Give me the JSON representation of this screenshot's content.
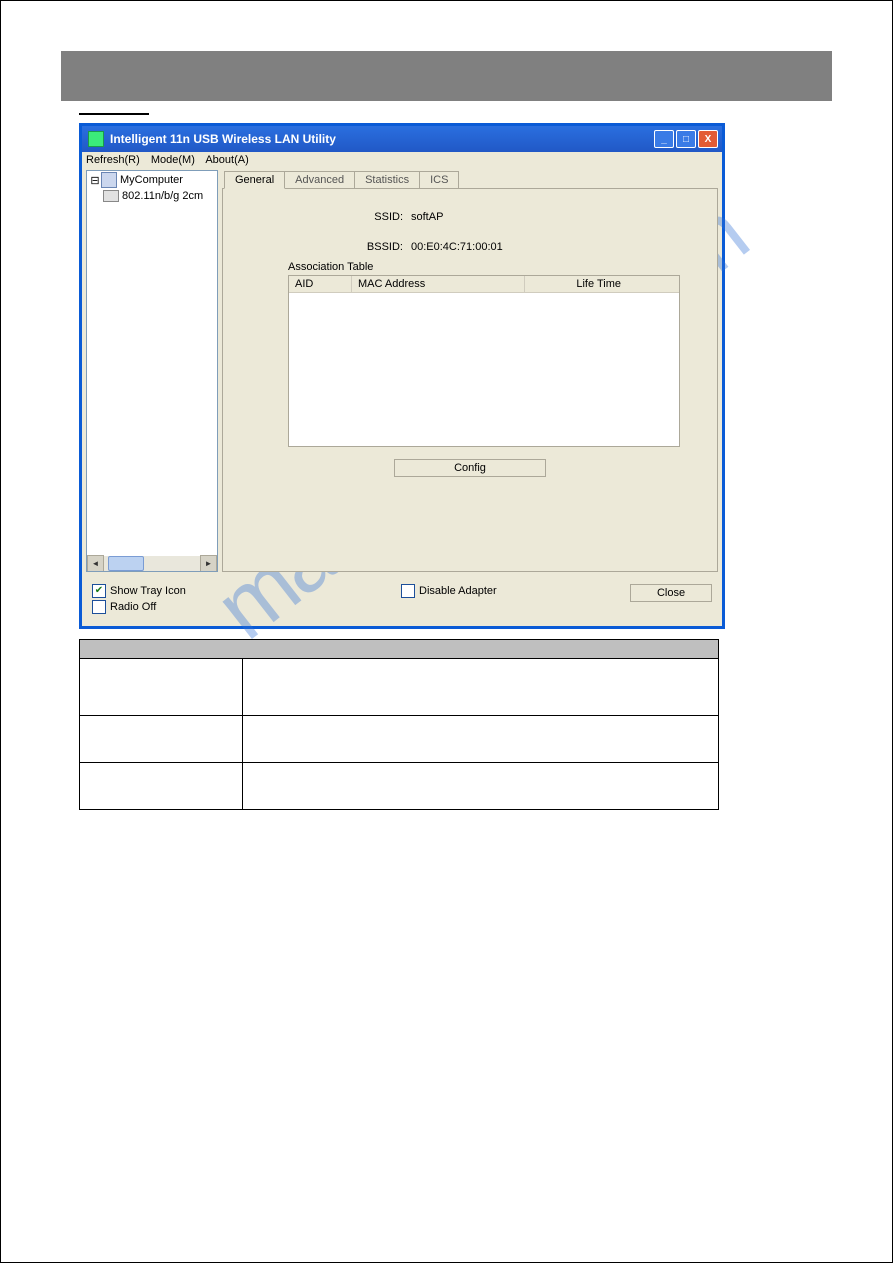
{
  "window": {
    "title": "Intelligent 11n USB Wireless LAN Utility",
    "menu": {
      "refresh": "Refresh(R)",
      "mode": "Mode(M)",
      "about": "About(A)"
    },
    "tree": {
      "root": "MyComputer",
      "adapter": "802.11n/b/g 2cm"
    },
    "tabs": {
      "general": "General",
      "advanced": "Advanced",
      "statistics": "Statistics",
      "ics": "ICS"
    },
    "general": {
      "ssid_label": "SSID:",
      "ssid_value": "softAP",
      "bssid_label": "BSSID:",
      "bssid_value": "00:E0:4C:71:00:01",
      "assoc_label": "Association Table",
      "col_aid": "AID",
      "col_mac": "MAC Address",
      "col_life": "Life Time",
      "config_btn": "Config"
    },
    "bottom": {
      "show_tray": "Show Tray Icon",
      "radio_off": "Radio Off",
      "disable_adapter": "Disable Adapter",
      "close": "Close"
    }
  },
  "checks": {
    "show_tray": "✔",
    "radio_off": "",
    "disable_adapter": ""
  },
  "watermark": "manualshive.com",
  "info_table": {
    "rows": [
      {
        "c1": "",
        "c2": ""
      },
      {
        "c1": "",
        "c2": ""
      },
      {
        "c1": "",
        "c2": ""
      }
    ]
  }
}
